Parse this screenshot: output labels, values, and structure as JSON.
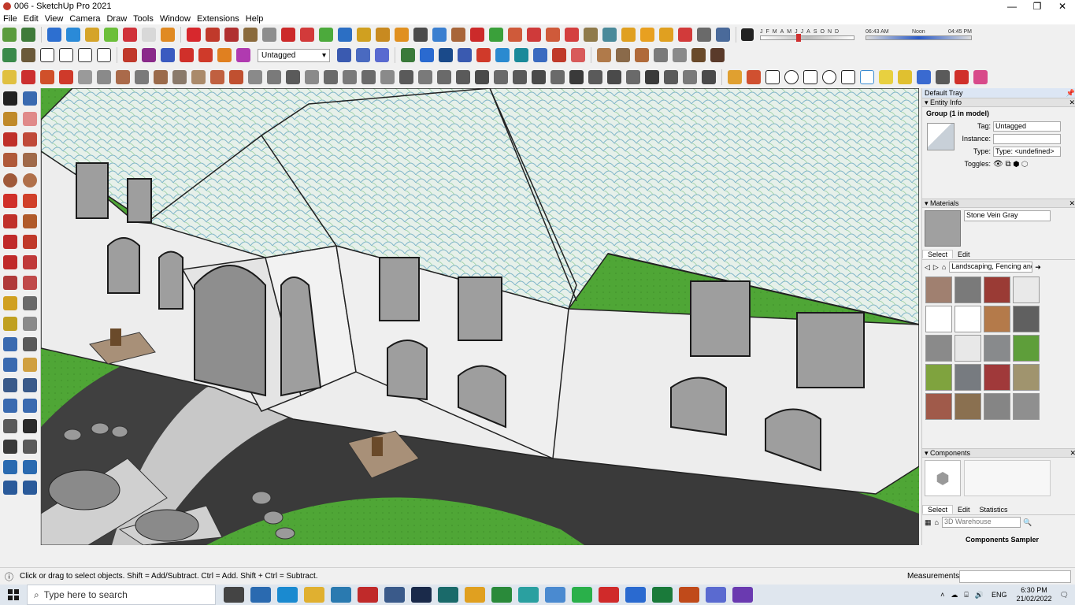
{
  "window": {
    "title": "006 - SketchUp Pro 2021",
    "controls": {
      "minimize": "—",
      "maximize": "❐",
      "close": "✕"
    }
  },
  "menu": [
    "File",
    "Edit",
    "View",
    "Camera",
    "Draw",
    "Tools",
    "Window",
    "Extensions",
    "Help"
  ],
  "toolbar": {
    "tag_select": "Untagged",
    "shadow_months": [
      "J",
      "F",
      "M",
      "A",
      "M",
      "J",
      "J",
      "A",
      "S",
      "O",
      "N",
      "D"
    ],
    "time_start": "06:43 AM",
    "time_noon": "Noon",
    "time_end": "04:45 PM"
  },
  "tray": {
    "title": "Default Tray",
    "entity_info": {
      "header": "Entity Info",
      "selection": "Group (1 in model)",
      "tag_label": "Tag:",
      "tag_value": "Untagged",
      "instance_label": "Instance:",
      "instance_value": "",
      "type_label": "Type:",
      "type_value": "Type: <undefined>",
      "toggles_label": "Toggles:"
    },
    "materials": {
      "header": "Materials",
      "current": "Stone Vein Gray",
      "tab_select": "Select",
      "tab_edit": "Edit",
      "library": "Landscaping, Fencing and ...",
      "swatch_colors": [
        "#a08070",
        "#7a7a7a",
        "#9a3b35",
        "#e9e9e9",
        "#ffffff",
        "#ffffff",
        "#b47a4a",
        "#606060",
        "#8a8a8a",
        "#e8e8e8",
        "#888a8c",
        "#5e9e3a",
        "#7fa33e",
        "#777b80",
        "#a0393a",
        "#a0946e",
        "#a05a4a",
        "#8a7050",
        "#858585",
        "#8f8f8f"
      ]
    },
    "components": {
      "header": "Components",
      "tab_select": "Select",
      "tab_edit": "Edit",
      "tab_statistics": "Statistics",
      "search_placeholder": "3D Warehouse",
      "sampler": "Components Sampler"
    }
  },
  "status": {
    "hint": "Click or drag to select objects. Shift = Add/Subtract. Ctrl = Add. Shift + Ctrl = Subtract.",
    "measurements_label": "Measurements",
    "measurements_value": ""
  },
  "taskbar": {
    "search_placeholder": "Type here to search",
    "language": "ENG",
    "time": "6:30 PM",
    "date": "21/02/2022"
  },
  "colors": {
    "roof": "#e6f0ea",
    "wall": "#ededed",
    "grass": "#4fa636",
    "driveway": "#3a3a3a",
    "accent": "#2a5ac8"
  }
}
